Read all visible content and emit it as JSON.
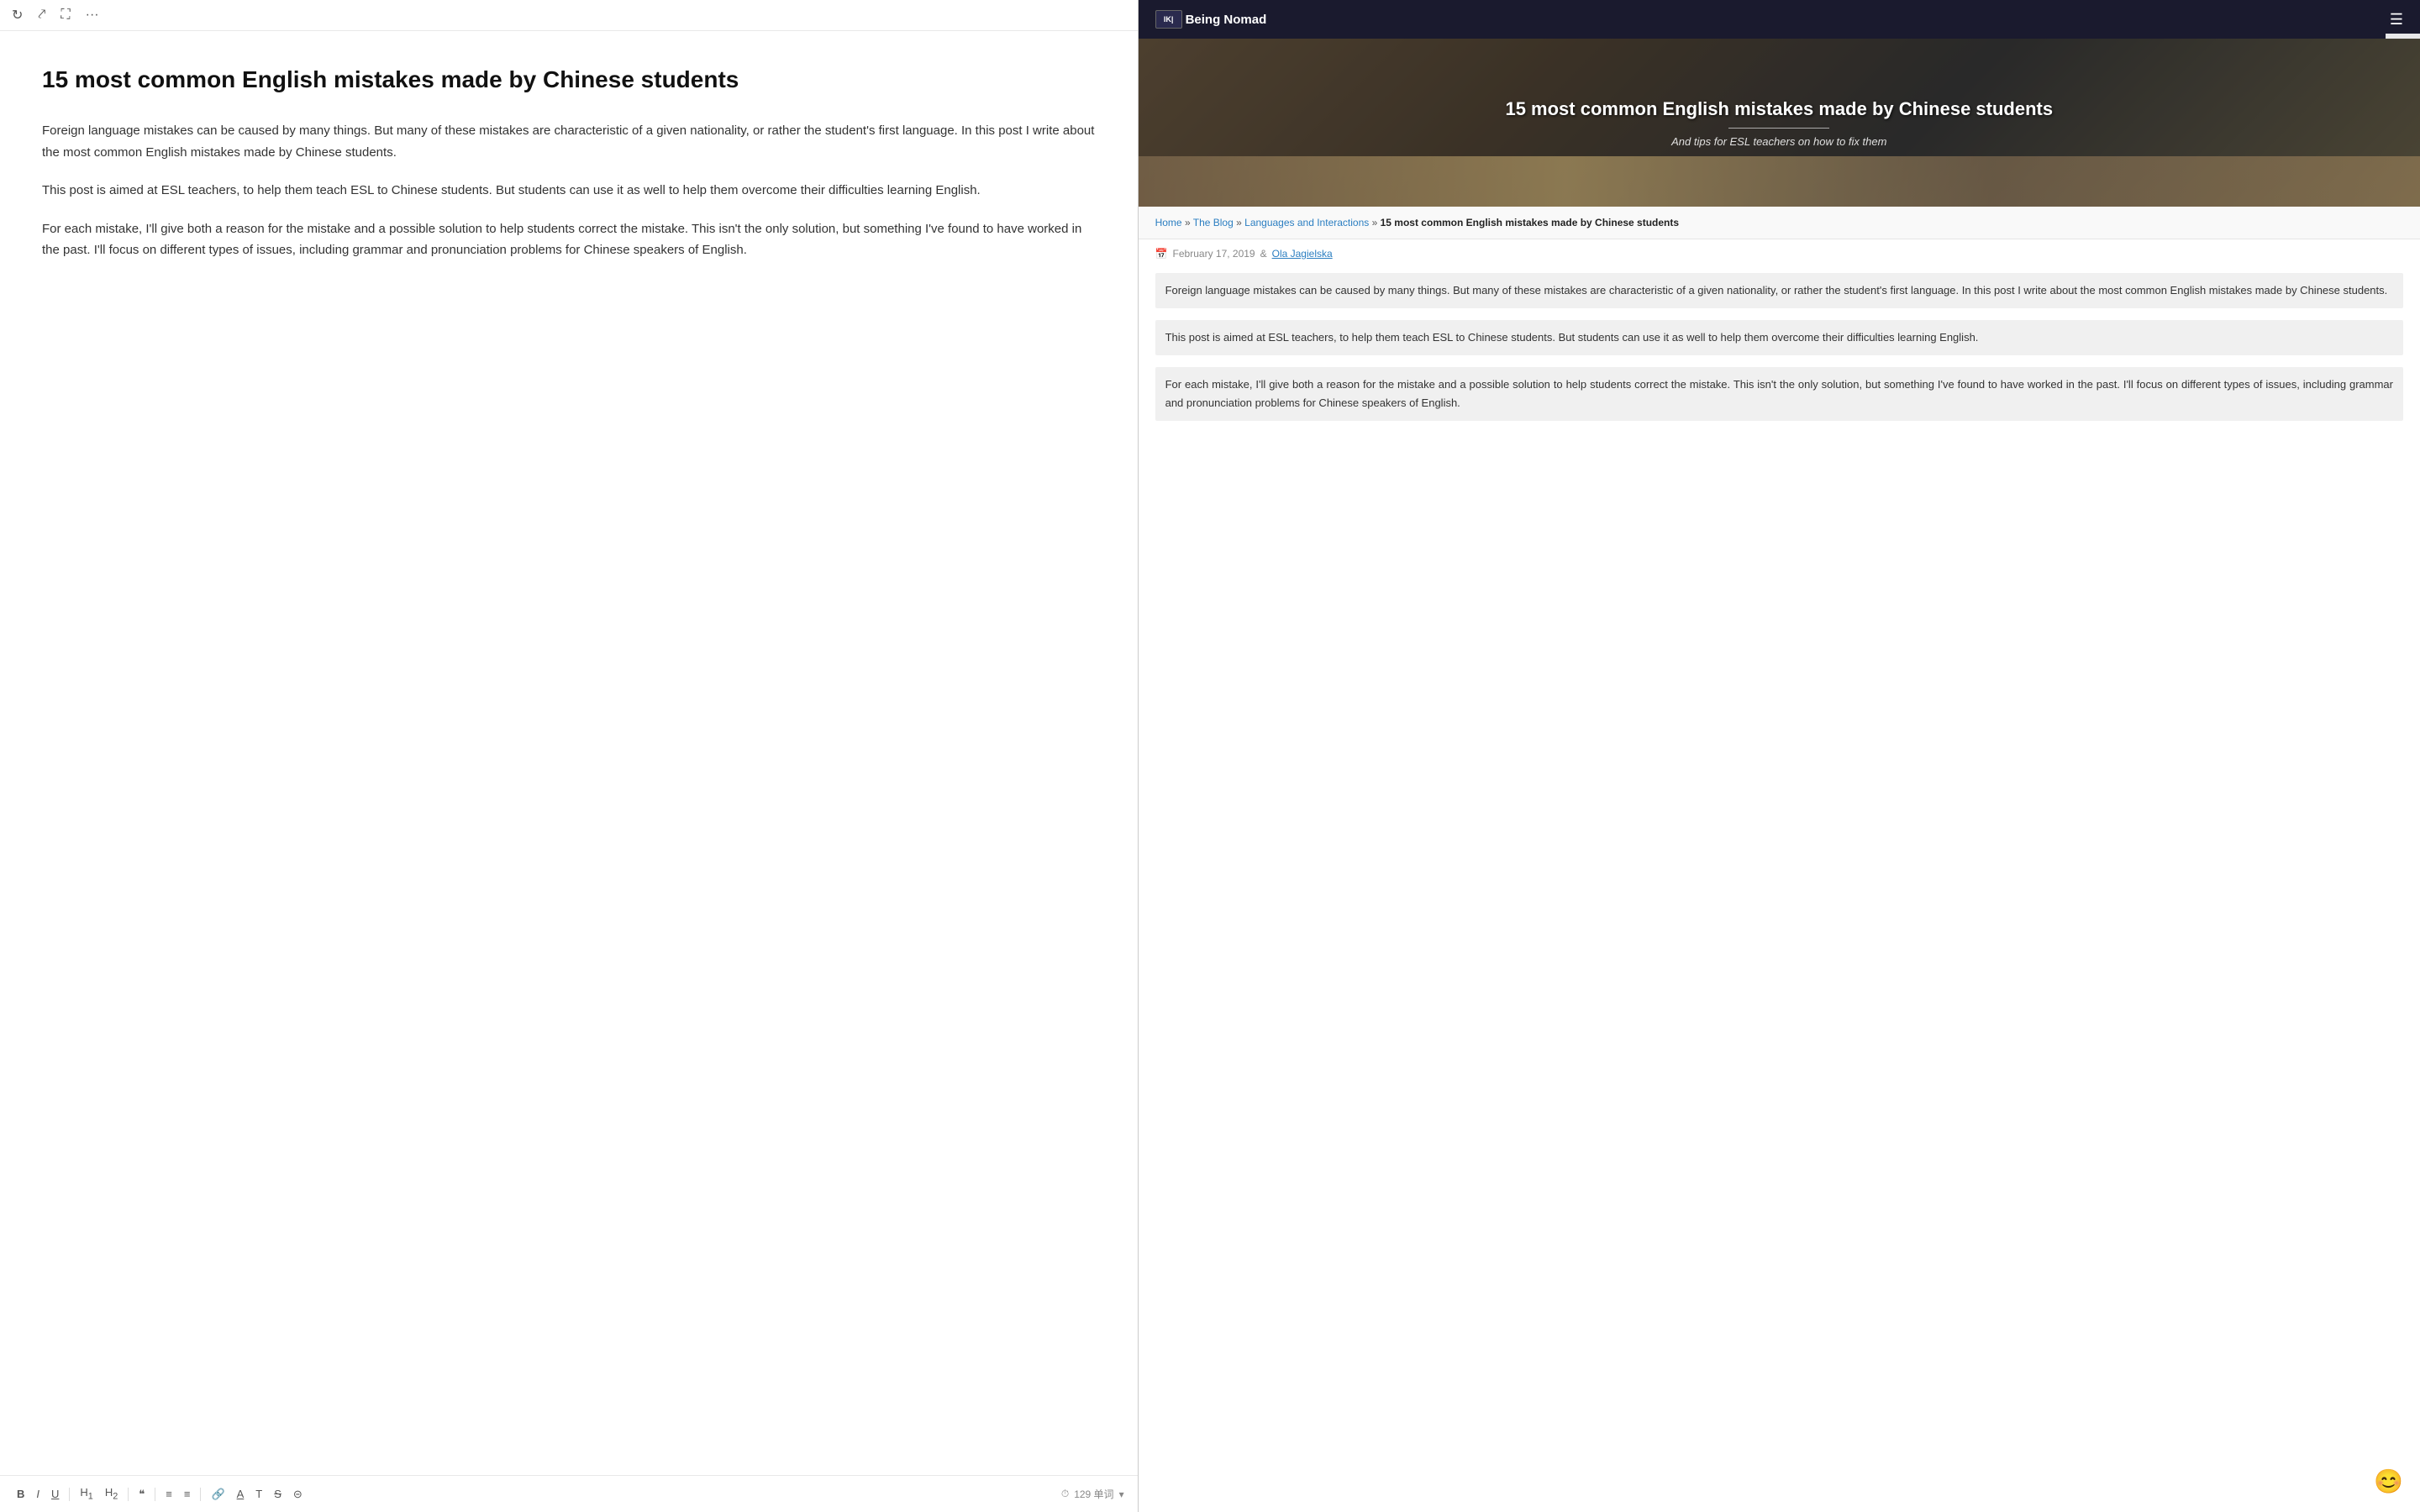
{
  "editor": {
    "toolbar_top": {
      "refresh_icon": "↻",
      "share_icon": "⤤",
      "expand_icon": "⛶",
      "more_icon": "···"
    },
    "title": "15 most common English mistakes made by Chinese students",
    "paragraphs": [
      "Foreign language mistakes can be caused by many things. But many of these mistakes are characteristic of a given nationality, or rather the student's first language. In this post I write about the most common English mistakes made by Chinese students.",
      "This post is aimed at ESL teachers, to help them teach ESL to Chinese students. But students can use it as well to help them overcome their difficulties learning English.",
      "For each mistake, I'll give both a reason for the mistake and a possible solution to help students correct the mistake. This isn't the only solution, but something I've found to have worked in the past. I'll focus on different types of issues, including grammar and pronunciation problems for Chinese speakers of English."
    ],
    "toolbar_bottom": {
      "bold": "B",
      "italic": "I",
      "underline": "U",
      "heading1": "H₁",
      "heading2": "H₂",
      "quote": "❝",
      "list_ul": "≡",
      "list_ol": "≡",
      "link": "🔗",
      "underline2": "A",
      "typewriter": "T",
      "strikethrough": "S̶",
      "image": "⊡",
      "clock_icon": "⏱",
      "word_count": "129 单词",
      "dropdown_icon": "▾"
    }
  },
  "website": {
    "nav": {
      "logo_text": "Being Nomad",
      "logo_prefix": "IK|",
      "hamburger": "☰"
    },
    "hero": {
      "title": "15 most common English mistakes made by Chinese students",
      "subtitle": "And tips for ESL teachers on how to fix them"
    },
    "breadcrumb": {
      "home": "Home",
      "blog": "The Blog",
      "category": "Languages and Interactions",
      "current": "15 most common English mistakes made by Chinese students"
    },
    "meta": {
      "date": "February 17, 2019",
      "author": "Ola Jagielska",
      "calendar_icon": "📅",
      "author_icon": "&"
    },
    "content": {
      "paragraphs": [
        "Foreign language mistakes can be caused by many things. But many of these mistakes are characteristic of a given nationality, or rather the student's first language. In this post I write about the most common English mistakes made by Chinese students.",
        "This post is aimed at ESL teachers, to help them teach ESL to Chinese students. But students can use it as well to help them overcome their difficulties learning English.",
        "For each mistake, I'll give both a reason for the mistake and a possible solution to help students correct the mistake. This isn't the only solution, but something I've found to have worked in the past. I'll focus on different types of issues, including grammar and pronunciation problems for Chinese speakers of English."
      ]
    },
    "sidebar_icons": {
      "check": "✓",
      "code": "</>"
    },
    "emoji": "😊"
  }
}
